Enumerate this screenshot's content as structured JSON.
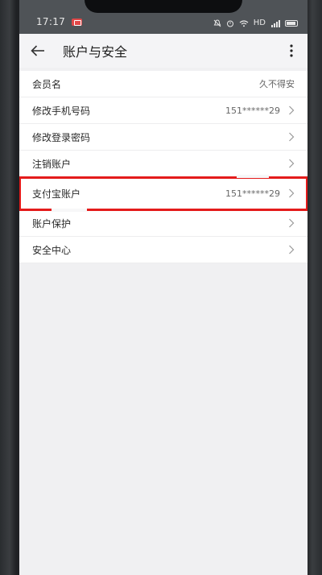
{
  "status_bar": {
    "time": "17:17",
    "network": "HD"
  },
  "header": {
    "title": "账户与安全"
  },
  "rows": [
    {
      "label": "会员名",
      "value": "久不得安",
      "has_chevron": false
    },
    {
      "label": "修改手机号码",
      "value": "151******29",
      "has_chevron": true
    },
    {
      "label": "修改登录密码",
      "value": "",
      "has_chevron": true
    },
    {
      "label": "注销账户",
      "value": "",
      "has_chevron": true
    },
    {
      "label": "支付宝账户",
      "value": "151******29",
      "has_chevron": true,
      "highlighted": true
    },
    {
      "label": "账户保护",
      "value": "",
      "has_chevron": true
    },
    {
      "label": "安全中心",
      "value": "",
      "has_chevron": true
    }
  ],
  "colors": {
    "highlight": "#e41b1b",
    "status_bar": "#4f5357",
    "background": "#f0f0f2"
  }
}
